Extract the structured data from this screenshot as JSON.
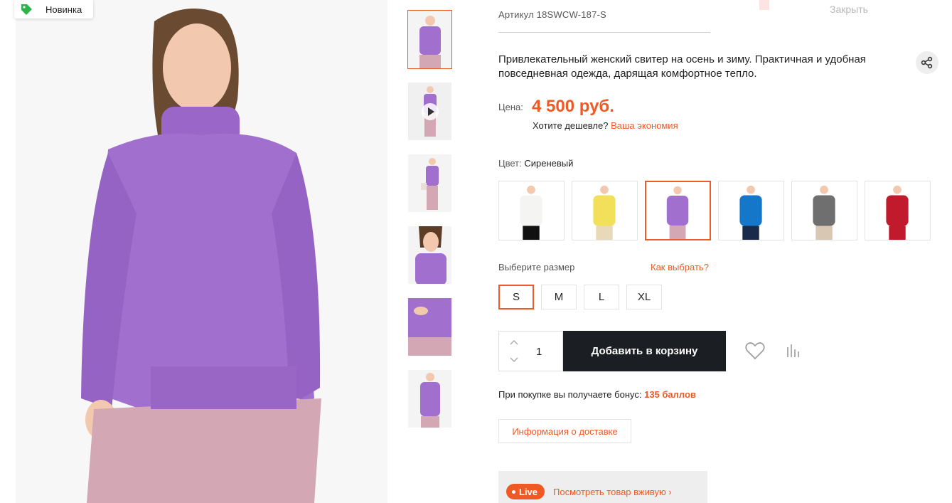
{
  "badge": {
    "label": "Новинка",
    "color": "#2db34a",
    "icon": "tag-icon"
  },
  "product": {
    "article": "Артикул 18SWCW-187-S",
    "close_label": "Закрыть",
    "description": "Привлекательный женский свитер на осень и зиму. Практичная и удобная повседневная одежда, дарящая комфортное тепло."
  },
  "price": {
    "label": "Цена:",
    "value": "4 500 руб.",
    "cheaper_text": "Хотите дешевле?",
    "cheaper_link": "Ваша экономия"
  },
  "color": {
    "label": "Цвет:",
    "selected": "Сиреневый",
    "options": [
      {
        "sweater": "#f4f4f2",
        "pants": "#111111"
      },
      {
        "sweater": "#f3e05a",
        "pants": "#e8d9b8"
      },
      {
        "sweater": "#a170cf",
        "pants": "#d3a8b4"
      },
      {
        "sweater": "#1477c9",
        "pants": "#1a2a4a"
      },
      {
        "sweater": "#6f6f6f",
        "pants": "#d8c7b2"
      },
      {
        "sweater": "#c01a2c",
        "pants": "#c01a2c"
      }
    ]
  },
  "size": {
    "label": "Выберите размер",
    "how_to_choose": "Как выбрать?",
    "options": [
      "S",
      "M",
      "L",
      "XL"
    ]
  },
  "cart": {
    "quantity": "1",
    "add_label": "Добавить в корзину"
  },
  "bonus": {
    "text": "При покупке вы получаете бонус:",
    "value": "135 баллов"
  },
  "delivery_label": "Информация о доставке",
  "live": {
    "badge": "Live",
    "link": "Посмотреть товар вживую ›"
  },
  "colors": {
    "accent": "#ef5a24",
    "dark": "#1b1f23",
    "sweater": "#a170cf",
    "skirt": "#d3a8b4"
  }
}
